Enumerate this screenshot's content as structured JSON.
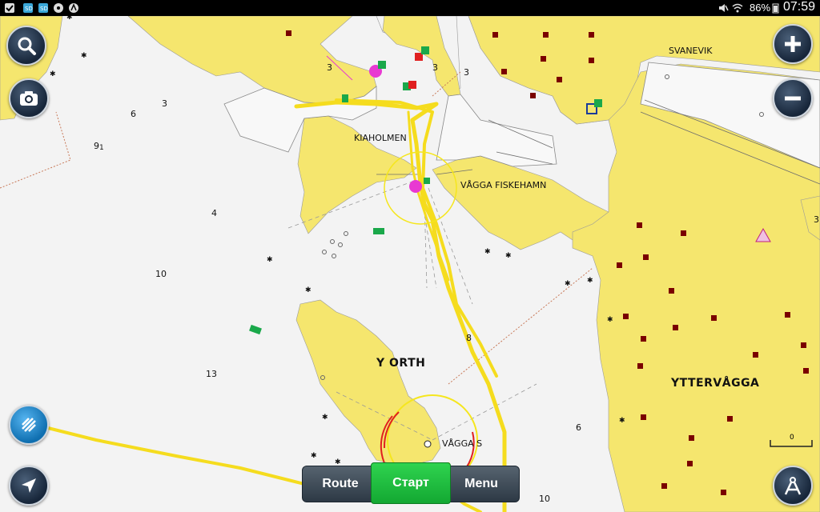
{
  "status_bar": {
    "left_icons": [
      "check-icon",
      "sd-card-icon",
      "sd-card-icon",
      "notification-icon",
      "compass-app-icon"
    ],
    "right_icons": [
      "mute-icon",
      "wifi-icon",
      "battery-icon"
    ],
    "battery": "86%",
    "time": "07:59"
  },
  "map": {
    "place_labels": [
      "KIAHOLMEN",
      "VÅGGA FISKEHAMN",
      "SVANEVIK",
      "VÅGGA S"
    ],
    "region_labels": [
      "Y ORTH",
      "YTTERVÅGGA"
    ],
    "depths": [
      "3",
      "3",
      "3",
      "6",
      "3",
      "9",
      "1",
      "4",
      "10",
      "13",
      "8",
      "6",
      "10",
      "3"
    ],
    "scale": "0",
    "colors": {
      "land": "#f5e66e",
      "water": "#f3f3f3",
      "track": "#f5dc1e",
      "hazard_red": "#7a0000"
    }
  },
  "controls": {
    "zoom_search_icon": "magnifier-icon",
    "camera_icon": "camera-icon",
    "zoom_in_icon": "plus-icon",
    "zoom_out_icon": "minus-icon",
    "layers_icon": "chart-layers-icon",
    "navigate_icon": "navigation-arrow-icon",
    "compass_icon": "compass-rose-icon"
  },
  "bottom_bar": {
    "route": "Route",
    "start": "Старт",
    "menu": "Menu"
  }
}
